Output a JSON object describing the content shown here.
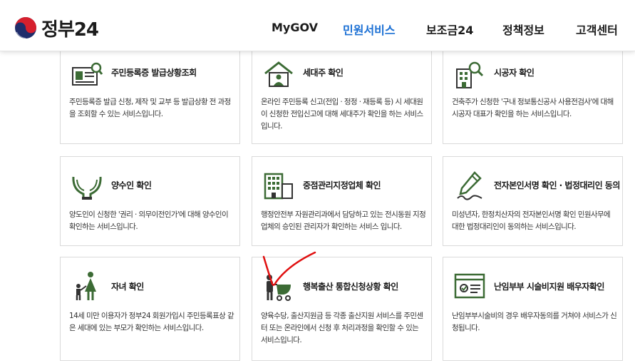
{
  "header": {
    "logo_text": "정부24",
    "nav": [
      {
        "label": "MyGOV",
        "active": false
      },
      {
        "label": "민원서비스",
        "active": true
      },
      {
        "label": "보조금24",
        "active": false
      },
      {
        "label": "정책정보",
        "active": false
      },
      {
        "label": "고객센터",
        "active": false
      }
    ]
  },
  "colors": {
    "accent": "#1a6fd4",
    "icon_green": "#3c6b35",
    "annotation_red": "#e01010"
  },
  "cards": [
    {
      "title": "주민등록증 발급상황조회",
      "icon": "id-card-search-icon",
      "desc": "주민등록증 발급 신청, 제작 및 교부 등 발급상황 전 과정을 조회할 수 있는 서비스입니다."
    },
    {
      "title": "세대주 확인",
      "icon": "house-person-icon",
      "desc": "온라인 주민등록 신고(전입 · 정정 · 재등록 등) 시 세대원이 신청한 전입신고에 대해 세대주가 확인을 하는 서비스입니다."
    },
    {
      "title": "시공자 확인",
      "icon": "building-search-icon",
      "desc": "건축주가 신청한 '구내 정보통신공사 사용전검사'에 대해 시공자 대표가 확인을 하는 서비스입니다."
    },
    {
      "title": "양수인 확인",
      "icon": "hands-icon",
      "desc": "양도인이 신청한 '권리 · 의무이전인가'에 대해 양수인이 확인하는 서비스입니다."
    },
    {
      "title": "중점관리지정업체 확인",
      "icon": "office-building-icon",
      "desc": "행정안전부 자원관리과에서 담당하고 있는 전시동원 지정업체의 승인된 관리자가 확인하는 서비스 입니다."
    },
    {
      "title": "전자본인서명 확인 · 법정대리인 동의",
      "icon": "pen-signature-icon",
      "desc": "미성년자, 한정치산자의 전자본인서명 확인 민원사무에 대한 법정대리인이 동의하는 서비스입니다."
    },
    {
      "title": "자녀 확인",
      "icon": "parent-child-icon",
      "desc": "14세 미만 이용자가 정부24 회원가입시 주민등록표상 같은 세대에 있는 부모가 확인하는 서비스입니다."
    },
    {
      "title": "행복출산 통합신청상황 확인",
      "icon": "parent-stroller-icon",
      "desc": "양육수당, 출산지원금 등 각종 출산지원 서비스를 주민센터 또는 온라인에서 신청 후 처리과정을 확인할 수 있는 서비스입니다."
    },
    {
      "title": "난임부부 시술비지원 배우자확인",
      "icon": "checklist-window-icon",
      "desc": "난임부부시술비의 경우 배우자동의를 거쳐야 서비스가 신청됩니다."
    }
  ]
}
